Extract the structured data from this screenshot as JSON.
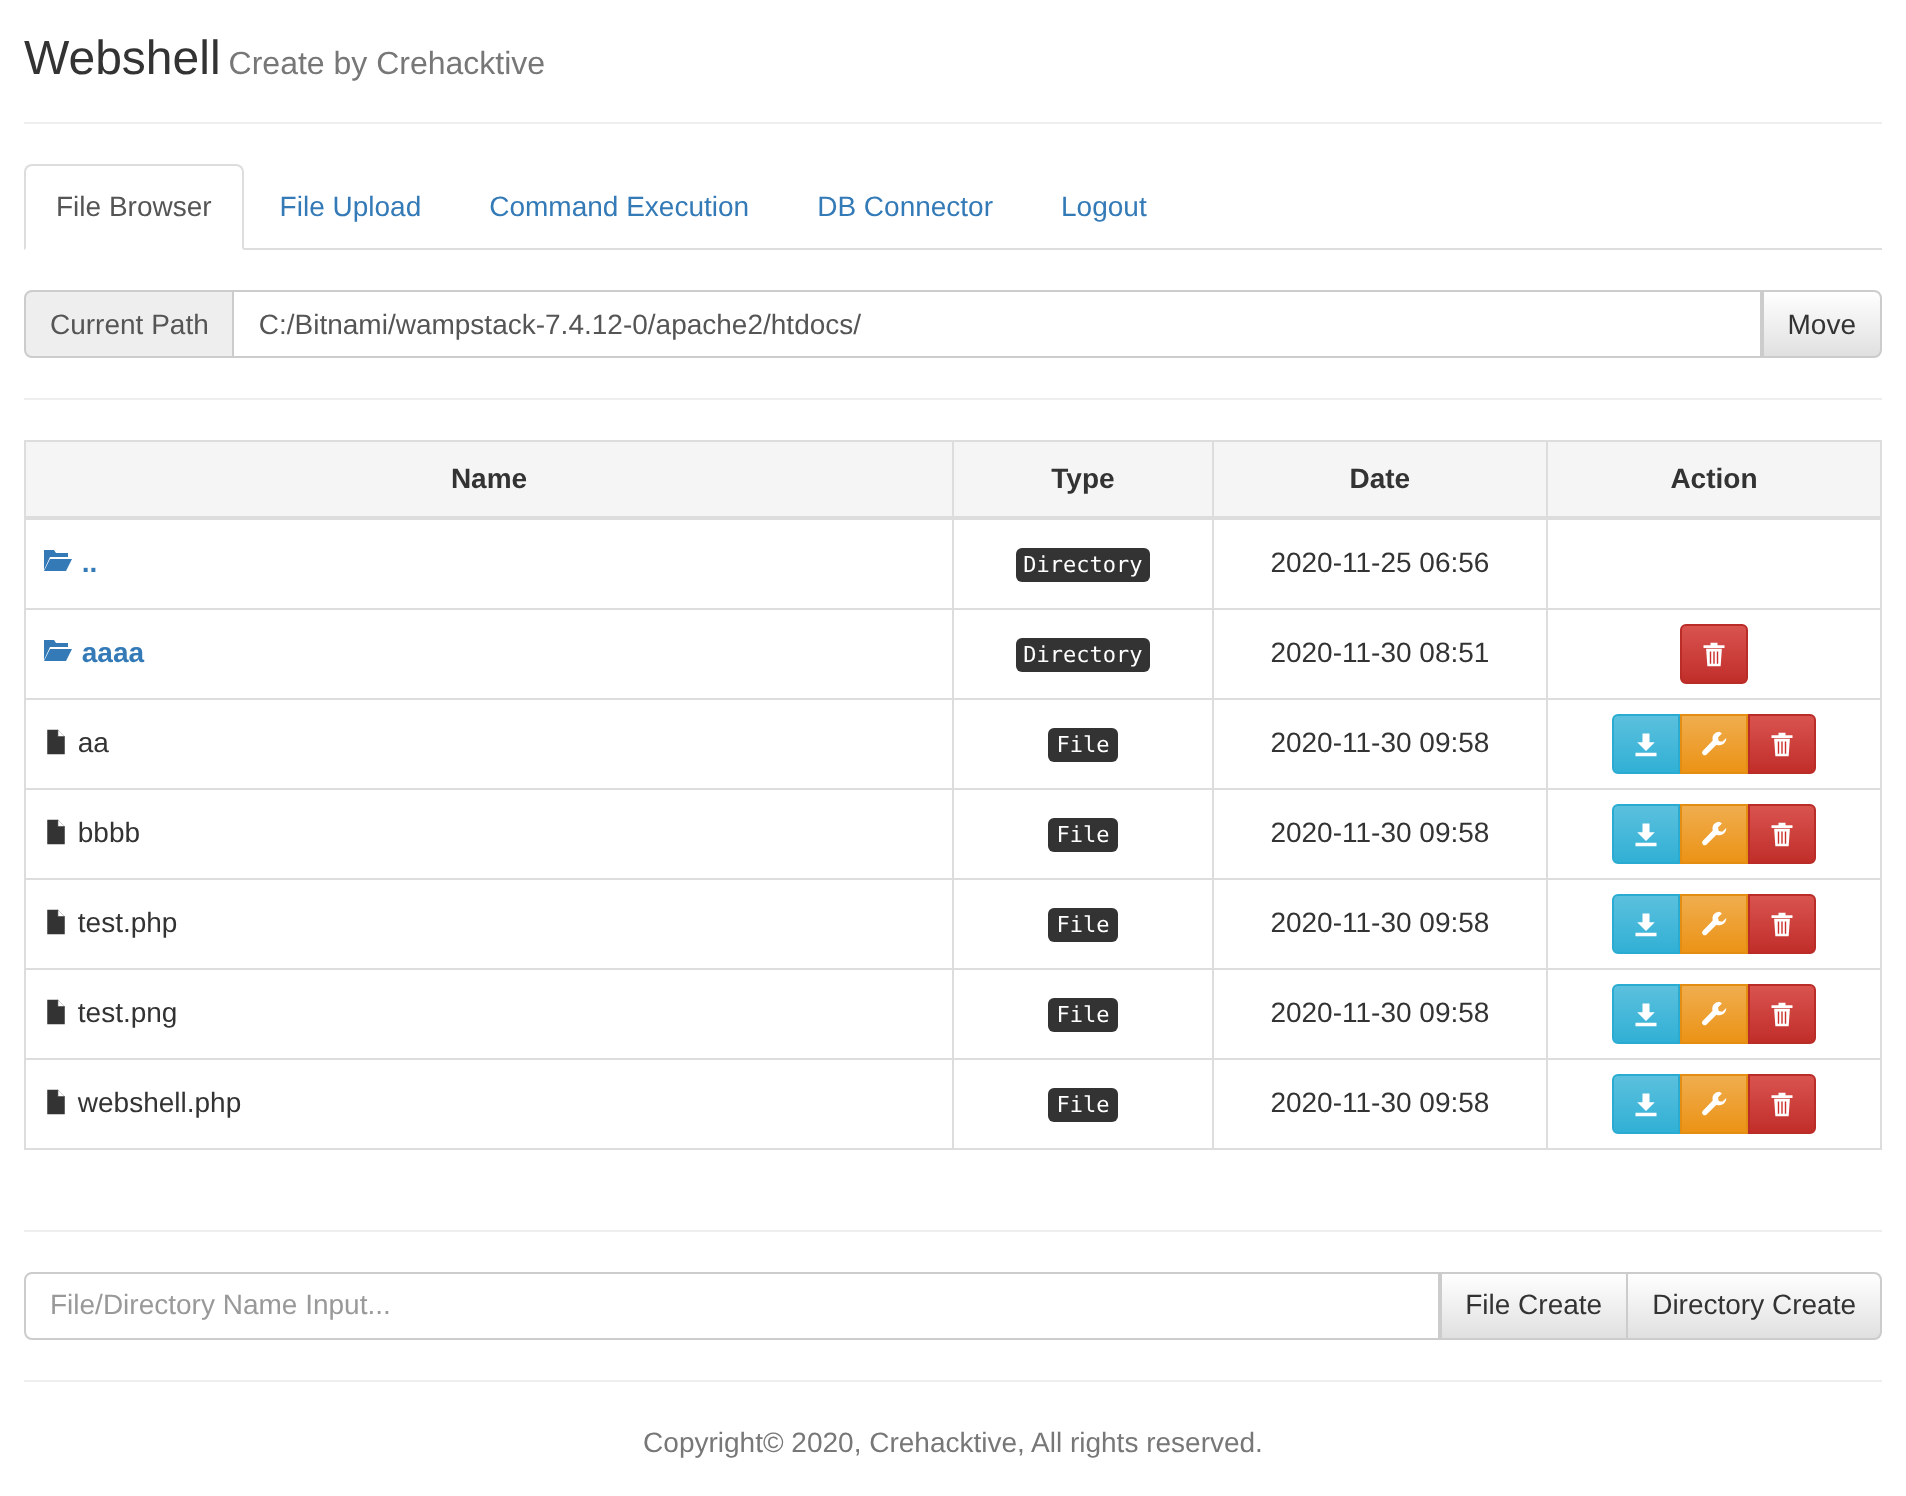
{
  "header": {
    "title": "Webshell",
    "subtitle": "Create by Crehacktive"
  },
  "tabs": [
    {
      "label": "File Browser",
      "selected": true
    },
    {
      "label": "File Upload",
      "selected": false
    },
    {
      "label": "Command Execution",
      "selected": false
    },
    {
      "label": "DB Connector",
      "selected": false
    },
    {
      "label": "Logout",
      "selected": false
    }
  ],
  "path_bar": {
    "label": "Current Path",
    "value": "C:/Bitnami/wampstack-7.4.12-0/apache2/htdocs/",
    "button": "Move"
  },
  "table": {
    "columns": [
      "Name",
      "Type",
      "Date",
      "Action"
    ],
    "rows": [
      {
        "kind": "directory",
        "name": "..",
        "type": "Directory",
        "date": "2020-11-25 06:56",
        "actions": []
      },
      {
        "kind": "directory",
        "name": "aaaa",
        "type": "Directory",
        "date": "2020-11-30 08:51",
        "actions": [
          {
            "kind": "delete"
          }
        ]
      },
      {
        "kind": "file",
        "name": "aa",
        "type": "File",
        "date": "2020-11-30 09:58",
        "actions": [
          {
            "kind": "download"
          },
          {
            "kind": "edit"
          },
          {
            "kind": "delete"
          }
        ]
      },
      {
        "kind": "file",
        "name": "bbbb",
        "type": "File",
        "date": "2020-11-30 09:58",
        "actions": [
          {
            "kind": "download"
          },
          {
            "kind": "edit"
          },
          {
            "kind": "delete"
          }
        ]
      },
      {
        "kind": "file",
        "name": "test.php",
        "type": "File",
        "date": "2020-11-30 09:58",
        "actions": [
          {
            "kind": "download"
          },
          {
            "kind": "edit"
          },
          {
            "kind": "delete"
          }
        ]
      },
      {
        "kind": "file",
        "name": "test.png",
        "type": "File",
        "date": "2020-11-30 09:58",
        "actions": [
          {
            "kind": "download"
          },
          {
            "kind": "edit"
          },
          {
            "kind": "delete"
          }
        ]
      },
      {
        "kind": "file",
        "name": "webshell.php",
        "type": "File",
        "date": "2020-11-30 09:58",
        "actions": [
          {
            "kind": "download"
          },
          {
            "kind": "edit"
          },
          {
            "kind": "delete"
          }
        ]
      }
    ]
  },
  "create_bar": {
    "placeholder": "File/Directory Name Input...",
    "buttons": [
      "File Create",
      "Directory Create"
    ]
  },
  "footer": "Copyright© 2020, Crehacktive, All rights reserved."
}
